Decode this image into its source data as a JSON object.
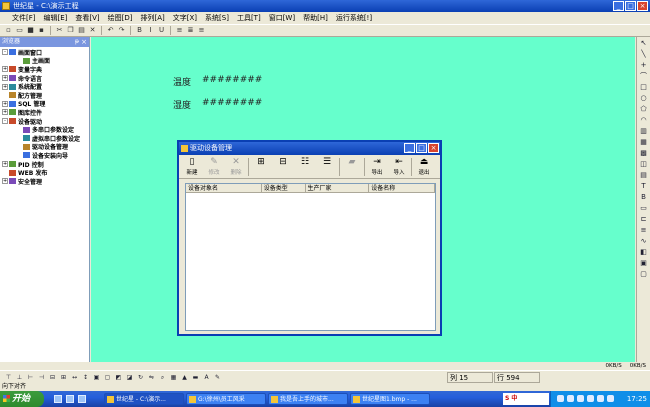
{
  "window": {
    "title": "世纪星 - C:\\演示工程"
  },
  "menu": [
    "文件[F]",
    "编辑[E]",
    "查看[V]",
    "绘图[D]",
    "排列[A]",
    "文字[X]",
    "系统[S]",
    "工具[T]",
    "窗口[W]",
    "帮助[H]",
    "运行系统[!]"
  ],
  "explorer": {
    "title": "浏览器",
    "items": [
      {
        "label": "画面窗口",
        "expander": "-",
        "indent": 0
      },
      {
        "label": "主画面",
        "expander": "",
        "indent": 1
      },
      {
        "label": "变量字典",
        "expander": "+",
        "indent": 0
      },
      {
        "label": "命令语言",
        "expander": "+",
        "indent": 0
      },
      {
        "label": "系统配置",
        "expander": "+",
        "indent": 0
      },
      {
        "label": "配方管理",
        "expander": "",
        "indent": 0
      },
      {
        "label": "SQL 管理",
        "expander": "+",
        "indent": 0
      },
      {
        "label": "图库控件",
        "expander": "+",
        "indent": 0
      },
      {
        "label": "设备驱动",
        "expander": "-",
        "indent": 0
      },
      {
        "label": "多串口参数设定",
        "expander": "",
        "indent": 1
      },
      {
        "label": "虚拟串口参数设定",
        "expander": "",
        "indent": 1
      },
      {
        "label": "驱动设备管理",
        "expander": "",
        "indent": 1
      },
      {
        "label": "设备安装向导",
        "expander": "",
        "indent": 1
      },
      {
        "label": "PID 控制",
        "expander": "+",
        "indent": 0
      },
      {
        "label": "WEB 发布",
        "expander": "",
        "indent": 0
      },
      {
        "label": "安全管理",
        "expander": "+",
        "indent": 0
      }
    ]
  },
  "canvas": {
    "temp_label": "温度",
    "temp_value": "########",
    "humidity_label": "湿度",
    "humidity_value": "########"
  },
  "dialog": {
    "title": "驱动设备管理",
    "toolbar": {
      "new": "新建",
      "modify": "修改",
      "delete": "删除",
      "export": "导出",
      "import": "导入",
      "exit": "退出"
    },
    "columns": [
      "设备对象名",
      "设备类型",
      "生产厂家",
      "设备名称"
    ]
  },
  "lowerbar": {
    "net_left": "0KB/S",
    "net_right": "0KB/S"
  },
  "status": {
    "left": "向下对齐",
    "col": "列 15",
    "row": "行 594"
  },
  "taskbar": {
    "start": "开始",
    "tasks": [
      "世纪星 - C:\\演示...",
      "G:\\徐州\\员工风采",
      "我是吾上手的城市...",
      "世纪星图1.bmp - ..."
    ],
    "ime": "S 中",
    "clock": "17:25"
  },
  "colors": {
    "canvas_bg": "#66ffcc",
    "title_blue": "#0a3fb3"
  }
}
